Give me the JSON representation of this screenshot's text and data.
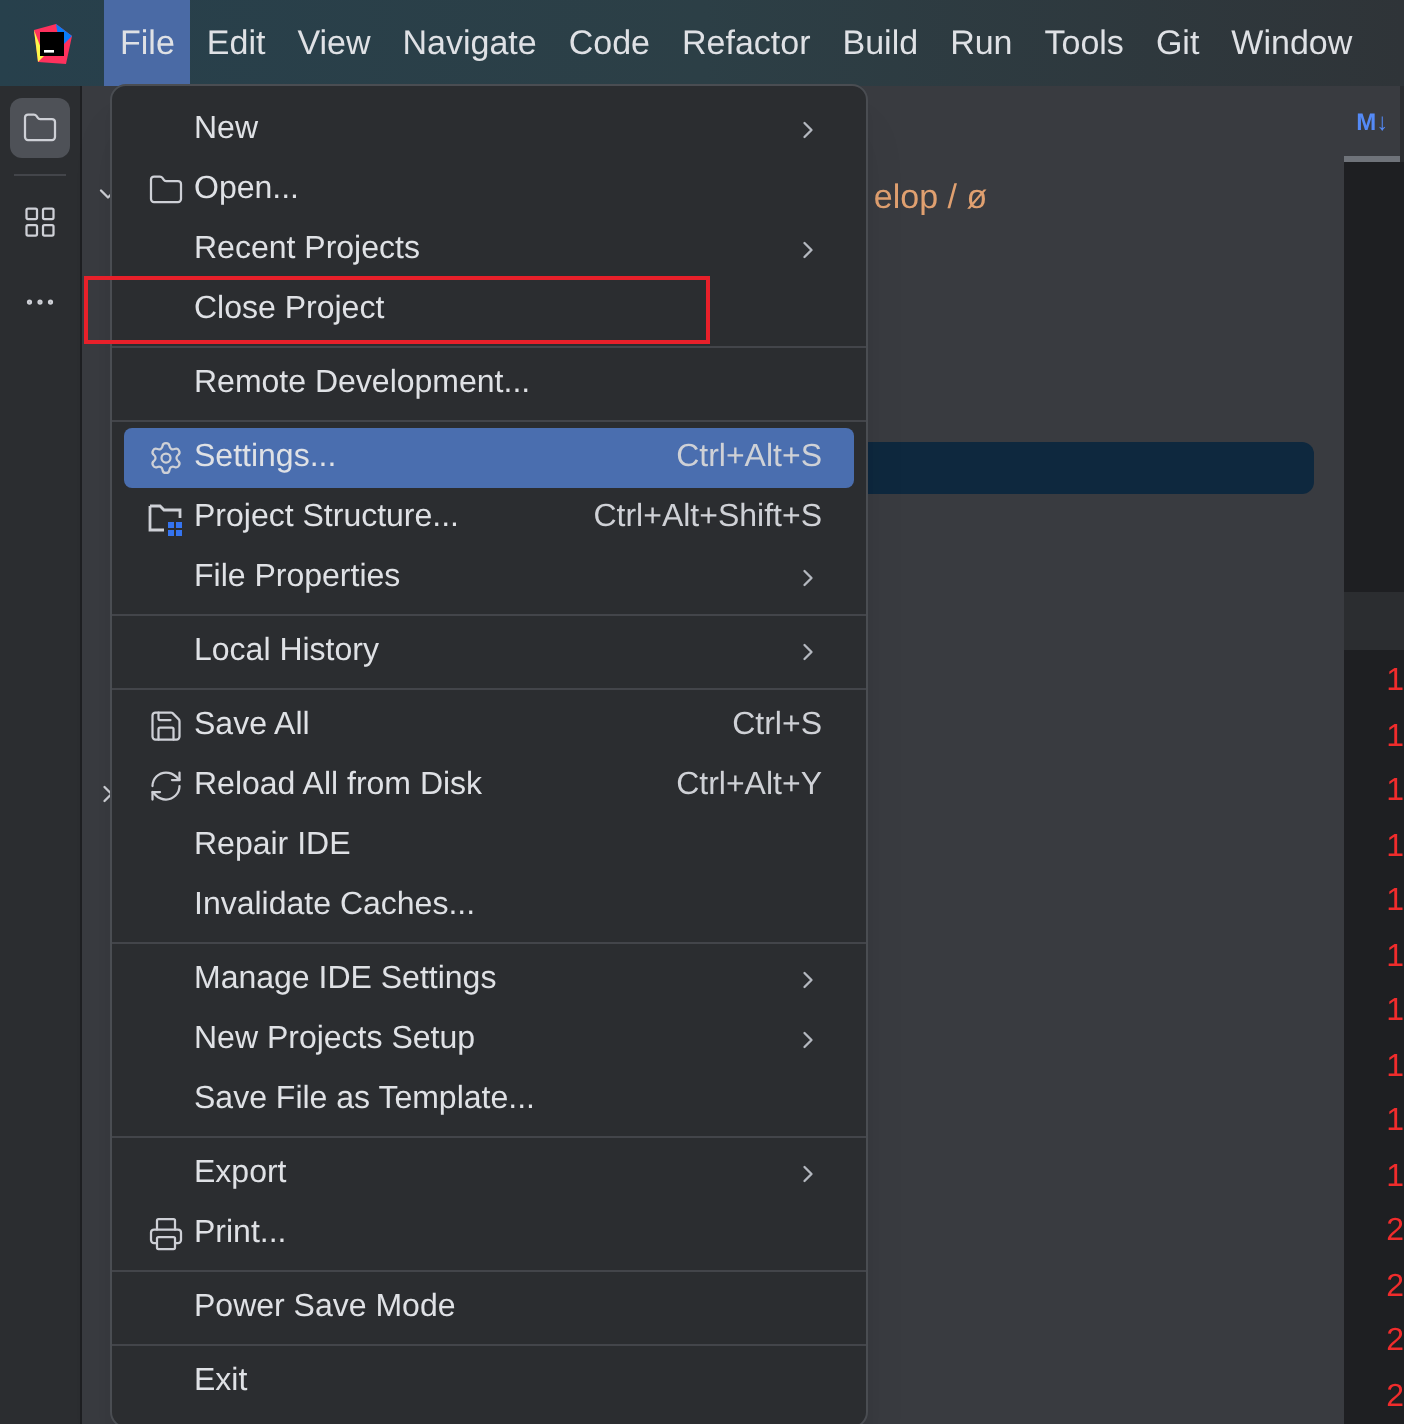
{
  "menu_bar": {
    "items": [
      {
        "label": "File",
        "selected": true
      },
      {
        "label": "Edit",
        "selected": false
      },
      {
        "label": "View",
        "selected": false
      },
      {
        "label": "Navigate",
        "selected": false
      },
      {
        "label": "Code",
        "selected": false
      },
      {
        "label": "Refactor",
        "selected": false
      },
      {
        "label": "Build",
        "selected": false
      },
      {
        "label": "Run",
        "selected": false
      },
      {
        "label": "Tools",
        "selected": false
      },
      {
        "label": "Git",
        "selected": false
      },
      {
        "label": "Window",
        "selected": false
      }
    ]
  },
  "tool_strip": [
    {
      "kind": "folder",
      "selected": true
    },
    {
      "kind": "structure",
      "selected": false
    },
    {
      "kind": "more",
      "selected": false
    }
  ],
  "project_panel": {
    "branch_fragment": "elop / ø"
  },
  "editor": {
    "tab_icon": "M↓",
    "line_numbers": [
      "1",
      "1",
      "1",
      "1",
      "1",
      "1",
      "1",
      "1",
      "1",
      "1",
      "2",
      "2",
      "2",
      "2"
    ]
  },
  "file_menu": {
    "groups": [
      [
        {
          "label": "New",
          "kind": "plain",
          "submenu": true,
          "selected": false
        },
        {
          "label": "Open...",
          "kind": "folder",
          "submenu": false,
          "selected": false
        },
        {
          "label": "Recent Projects",
          "kind": "plain",
          "submenu": true,
          "selected": false
        },
        {
          "label": "Close Project",
          "kind": "plain",
          "submenu": false,
          "outlined": true,
          "selected": false
        }
      ],
      [
        {
          "label": "Remote Development...",
          "kind": "plain",
          "submenu": false,
          "selected": false
        }
      ],
      [
        {
          "label": "Settings...",
          "kind": "gear",
          "shortcut": "Ctrl+Alt+S",
          "submenu": false,
          "selected": true
        },
        {
          "label": "Project Structure...",
          "kind": "structure",
          "shortcut": "Ctrl+Alt+Shift+S",
          "submenu": false,
          "selected": false
        },
        {
          "label": "File Properties",
          "kind": "plain",
          "submenu": true,
          "selected": false
        }
      ],
      [
        {
          "label": "Local History",
          "kind": "plain",
          "submenu": true,
          "selected": false
        }
      ],
      [
        {
          "label": "Save All",
          "kind": "save",
          "shortcut": "Ctrl+S",
          "submenu": false,
          "selected": false
        },
        {
          "label": "Reload All from Disk",
          "kind": "reload",
          "shortcut": "Ctrl+Alt+Y",
          "submenu": false,
          "selected": false
        },
        {
          "label": "Repair IDE",
          "kind": "plain",
          "submenu": false,
          "selected": false
        },
        {
          "label": "Invalidate Caches...",
          "kind": "plain",
          "submenu": false,
          "selected": false
        }
      ],
      [
        {
          "label": "Manage IDE Settings",
          "kind": "plain",
          "submenu": true,
          "selected": false
        },
        {
          "label": "New Projects Setup",
          "kind": "plain",
          "submenu": true,
          "selected": false
        },
        {
          "label": "Save File as Template...",
          "kind": "plain",
          "submenu": false,
          "selected": false
        }
      ],
      [
        {
          "label": "Export",
          "kind": "plain",
          "submenu": true,
          "selected": false
        },
        {
          "label": "Print...",
          "kind": "print",
          "submenu": false,
          "selected": false
        }
      ],
      [
        {
          "label": "Power Save Mode",
          "kind": "plain",
          "submenu": false,
          "selected": false
        }
      ],
      [
        {
          "label": "Exit",
          "kind": "plain",
          "submenu": false,
          "selected": false
        }
      ]
    ]
  }
}
